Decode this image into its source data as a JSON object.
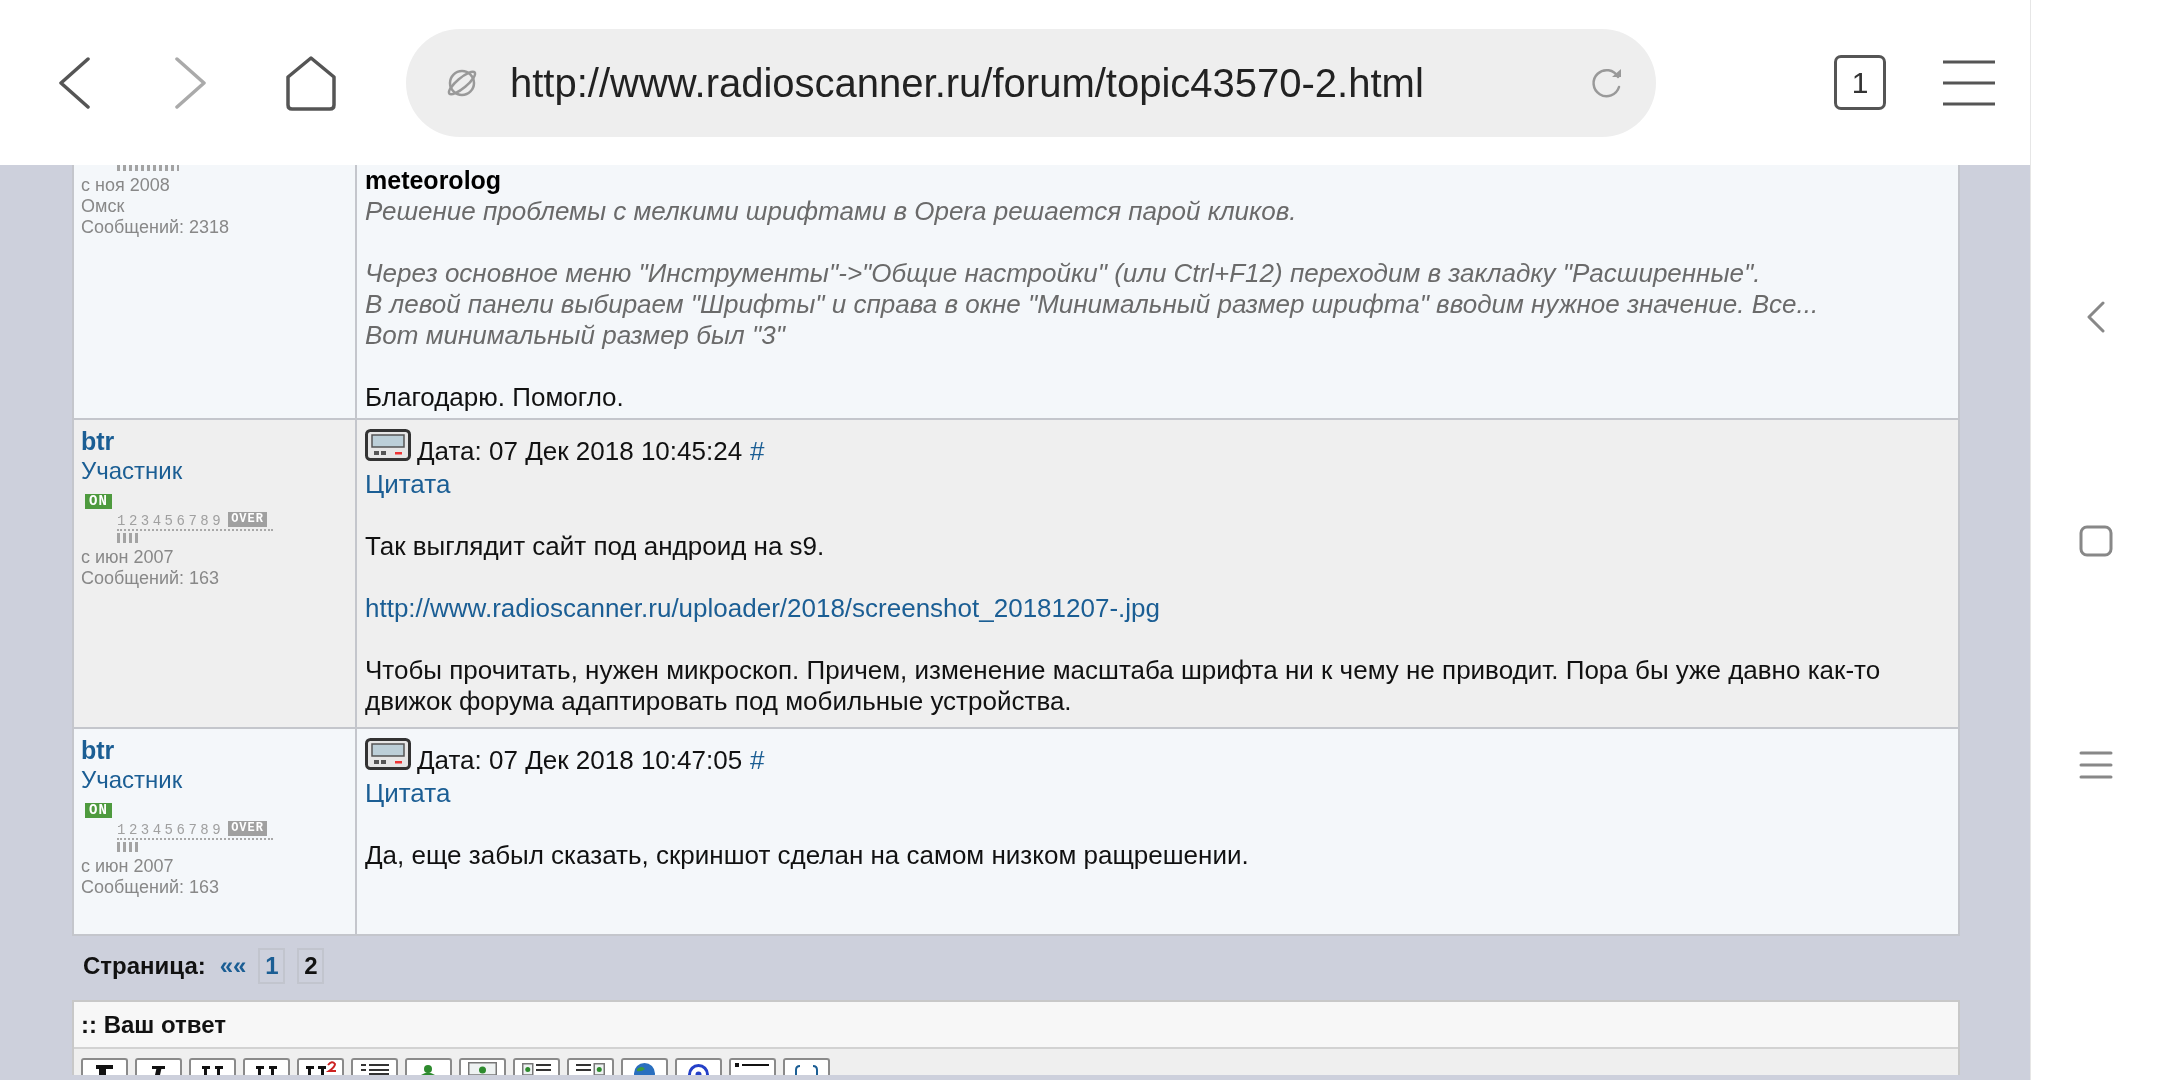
{
  "browser": {
    "url": "http://www.radioscanner.ru/forum/topic43570-2.html",
    "tab_count": "1"
  },
  "posts": [
    {
      "user": {
        "rank_meter": {
          "kind": "cropped"
        },
        "since": "с ноя 2008",
        "location": "Омск",
        "messages": "Сообщений: 2318"
      },
      "body": [
        {
          "kind": "quote",
          "author": "meteorolog",
          "paragraphs": [
            [
              "Решение проблемы с мелкими шрифтами в Opera решается парой кликов."
            ],
            [
              "Через основное меню \"Инструменты\"->\"Общие настройки\" (или Ctrl+F12) переходим в закладку \"Расширенные\".",
              "В левой панели выбираем \"Шрифты\" и справа в окне \"Минимальный размер шрифта\" вводим нужное значение. Все...",
              "Вот минимальный размер был \"3\""
            ]
          ]
        },
        {
          "kind": "text",
          "text": "Благодарю. Помогло."
        }
      ]
    },
    {
      "user": {
        "name": "btr",
        "title": "Участник",
        "badge": "ON",
        "rank_meter": {
          "kind": "scale",
          "scale": "123456789",
          "over": "OVER",
          "level": 0.15
        },
        "since": "с июн 2007",
        "messages": "Сообщений: 163"
      },
      "header": {
        "date": "Дата: 07 Дек 2018 10:45:24",
        "anchor": "#",
        "quote_link": "Цитата"
      },
      "body": [
        {
          "kind": "text",
          "text": "Так выглядит сайт под андроид на s9."
        },
        {
          "kind": "link",
          "text": "http://www.radioscanner.ru/uploader/2018/screenshot_20181207-.jpg"
        },
        {
          "kind": "text",
          "text": "Чтобы прочитать, нужен микроскоп. Причем, изменение масштаба шрифта ни к чему не приводит. Пора бы уже давно как-то движок форума адаптировать под мобильные устройства."
        }
      ]
    },
    {
      "user": {
        "name": "btr",
        "title": "Участник",
        "badge": "ON",
        "rank_meter": {
          "kind": "scale",
          "scale": "123456789",
          "over": "OVER",
          "level": 0.15
        },
        "since": "с июн 2007",
        "messages": "Сообщений: 163"
      },
      "header": {
        "date": "Дата: 07 Дек 2018 10:47:05",
        "anchor": "#",
        "quote_link": "Цитата"
      },
      "body": [
        {
          "kind": "text",
          "text": "Да, еще забыл сказать, скриншот сделан на самом низком ращрешении."
        }
      ]
    }
  ],
  "pagination": {
    "label": "Страница:",
    "first": "««",
    "pages": [
      {
        "label": "1",
        "selected": false
      },
      {
        "label": "2",
        "selected": true
      }
    ]
  },
  "reply": {
    "title": ":: Ваш ответ",
    "toolbar": [
      {
        "kind": "bold"
      },
      {
        "kind": "italic"
      },
      {
        "kind": "underline"
      },
      {
        "kind": "strike"
      },
      {
        "kind": "superscript"
      },
      {
        "kind": "list"
      },
      {
        "kind": "user"
      },
      {
        "kind": "image"
      },
      {
        "kind": "image_left"
      },
      {
        "kind": "image_right"
      },
      {
        "kind": "globe"
      },
      {
        "kind": "email"
      },
      {
        "kind": "rule"
      },
      {
        "kind": "code"
      }
    ]
  }
}
